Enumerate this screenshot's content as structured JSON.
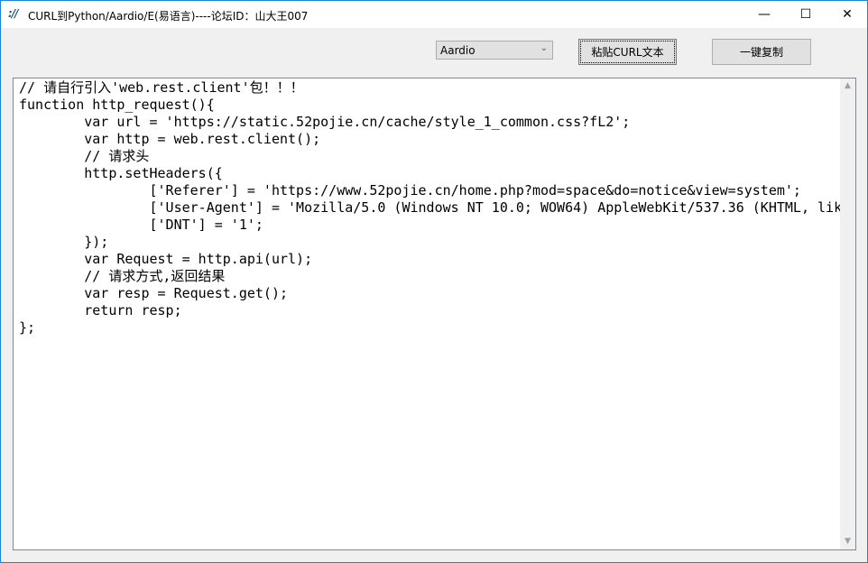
{
  "window": {
    "title": "CURL到Python/Aardio/E(易语言)----论坛ID：山大王007",
    "icon": "app-logo-icon",
    "controls": {
      "minimize": "—",
      "maximize": "☐",
      "close": "✕"
    }
  },
  "toolbar": {
    "language_select": {
      "value": "Aardio"
    },
    "paste_button": "粘贴CURL文本",
    "copy_button": "一键复制"
  },
  "editor": {
    "lines": [
      "// 请自行引入'web.rest.client'包！！！",
      "function http_request(){",
      "\tvar url = 'https://static.52pojie.cn/cache/style_1_common.css?fL2';",
      "\tvar http = web.rest.client();",
      "\t// 请求头",
      "\thttp.setHeaders({",
      "\t\t['Referer'] = 'https://www.52pojie.cn/home.php?mod=space&do=notice&view=system';",
      "\t\t['User-Agent'] = 'Mozilla/5.0 (Windows NT 10.0; WOW64) AppleWebKit/537.36 (KHTML, lik",
      "\t\t['DNT'] = '1';",
      "\t});",
      "\tvar Request = http.api(url);",
      "\t// 请求方式,返回结果",
      "\tvar resp = Request.get();",
      "\treturn resp;",
      "};"
    ]
  }
}
